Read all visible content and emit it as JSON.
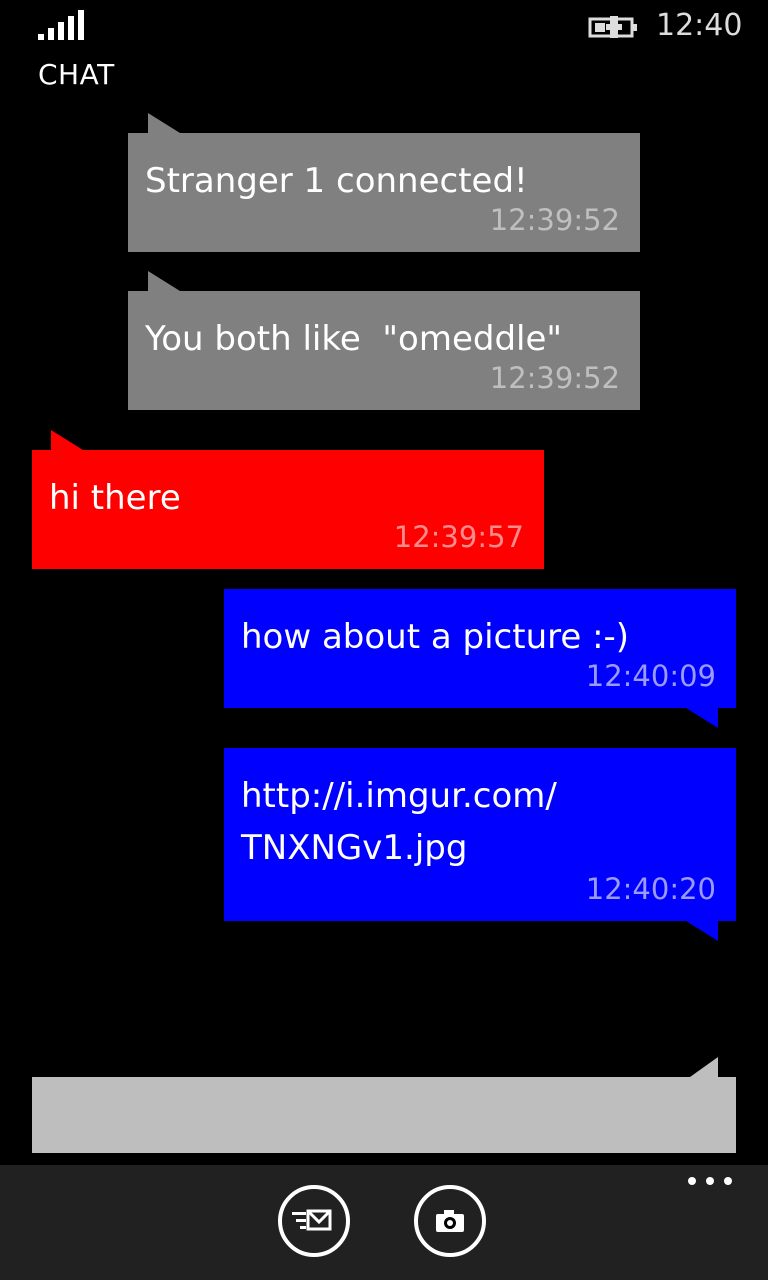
{
  "status_bar": {
    "time": "12:40",
    "signal_icon": "signal-strength-icon",
    "battery_icon": "battery-charging-icon"
  },
  "app": {
    "title": "CHAT"
  },
  "messages": [
    {
      "sender": "system",
      "text": "Stranger 1 connected!",
      "time": "12:39:52",
      "color": "#808080"
    },
    {
      "sender": "system",
      "text": "You both like  \"omeddle\"",
      "time": "12:39:52",
      "color": "#808080"
    },
    {
      "sender": "stranger",
      "text": "hi there",
      "time": "12:39:57",
      "color": "#ff0000"
    },
    {
      "sender": "me",
      "text": "how about a picture :-)",
      "time": "12:40:09",
      "color": "#0000ff"
    },
    {
      "sender": "me",
      "text": "http://i.imgur.com/\nTNXNGv1.jpg",
      "time": "12:40:20",
      "color": "#0000ff"
    }
  ],
  "composer": {
    "value": ""
  },
  "app_bar": {
    "buttons": [
      {
        "icon": "send-message-icon"
      },
      {
        "icon": "camera-icon"
      }
    ],
    "more_icon": "ellipsis-icon"
  }
}
